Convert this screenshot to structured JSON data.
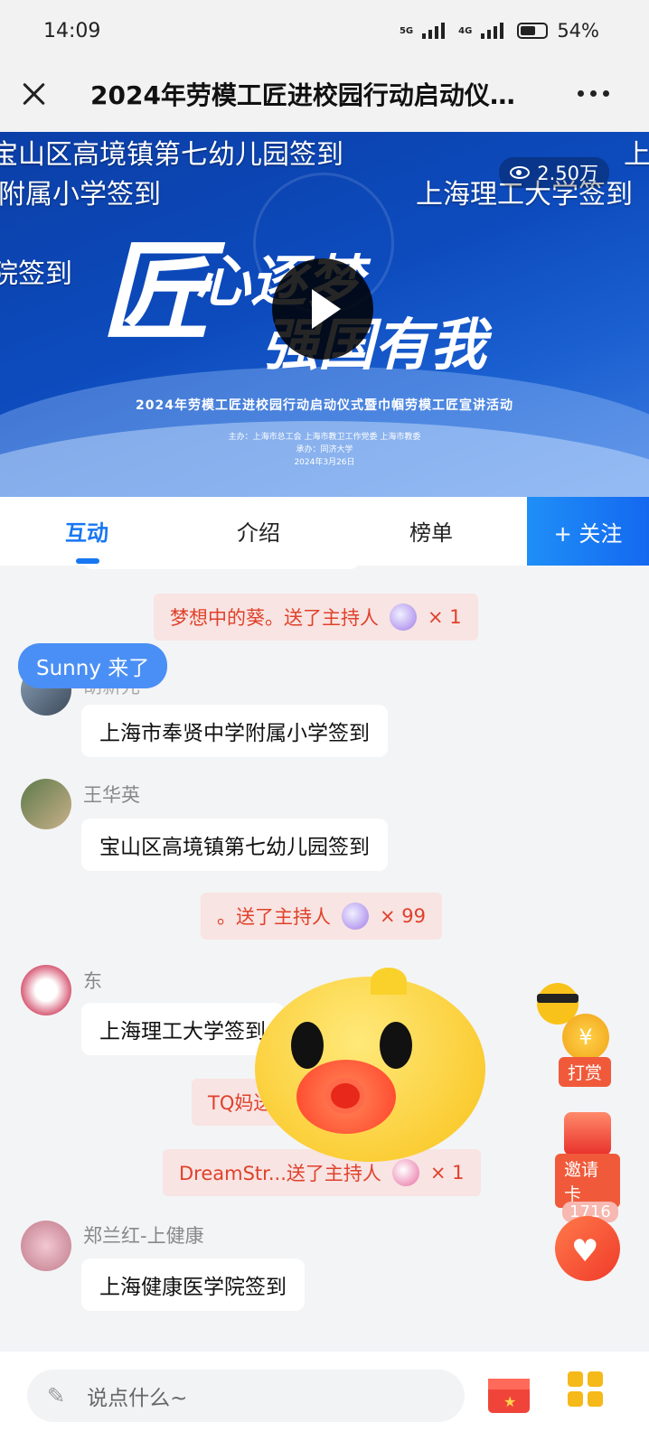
{
  "status": {
    "time": "14:09",
    "net1": "5G",
    "net2": "4G",
    "battery": "54%"
  },
  "titlebar": {
    "title": "2024年劳模工匠进校园行动启动仪…"
  },
  "video": {
    "danmaku": [
      "宝山区高境镇第七幼儿园签到",
      "附属小学签到",
      "上海理工大学签到",
      "院签到",
      "上"
    ],
    "views": "2.50万",
    "slogan1": "匠",
    "slogan2": "心逐梦",
    "slogan3": "强国有我",
    "subtitle": "2024年劳模工匠进校园行动启动仪式暨巾帼劳模工匠宣讲活动",
    "organizers": "主办：上海市总工会  上海市教卫工作党委  上海市教委",
    "host": "承办：同济大学",
    "date": "2024年3月26日"
  },
  "tabs": {
    "interact": "互动",
    "intro": "介绍",
    "rank": "榜单",
    "follow": "+ 关注"
  },
  "chat": {
    "notice": "Sunny 来了",
    "gift1": {
      "text": "梦想中的葵。送了主持人",
      "count": "× 1"
    },
    "msg1": {
      "user": "胡新元",
      "text": "上海市奉贤中学附属小学签到"
    },
    "msg2": {
      "user": "王华英",
      "text": "宝山区高境镇第七幼儿园签到"
    },
    "gift2": {
      "text": "。送了主持人",
      "count": "× 99"
    },
    "msg3": {
      "user": "东",
      "text": "上海理工大学签到"
    },
    "gift3": {
      "text": "TQ妈送了主持人",
      "count": ""
    },
    "gift4": {
      "text": "DreamStr...送了主持人",
      "count": "× 1"
    },
    "msg4": {
      "user": "郑兰红-上健康",
      "text": "上海健康医学院签到"
    }
  },
  "float": {
    "tip": "打赏",
    "tip_symbol": "¥",
    "invite": "邀请卡",
    "likes": "1716"
  },
  "bottom": {
    "placeholder": "说点什么~"
  },
  "colors": {
    "accent": "#1877f2",
    "gift_bg": "#f8e4e2",
    "gift_text": "#e0402b"
  }
}
